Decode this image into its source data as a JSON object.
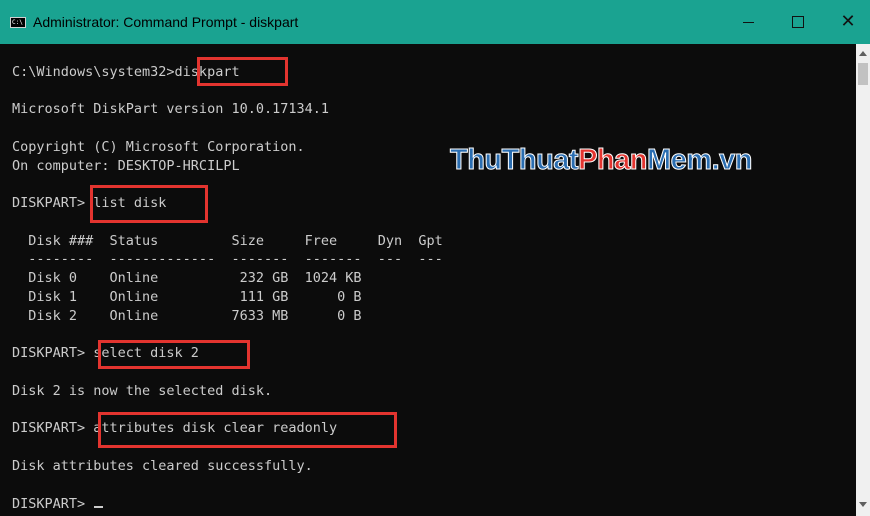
{
  "window": {
    "title": "Administrator: Command Prompt - diskpart",
    "icon_label": "C:\\",
    "minimize_icon": "minimize-icon",
    "maximize_icon": "maximize-icon",
    "close_icon": "close-icon",
    "close_glyph": "✕",
    "title_bar_color": "#1aa391"
  },
  "console": {
    "lines": [
      "C:\\Windows\\system32>diskpart",
      "Microsoft DiskPart version 10.0.17134.1",
      "Copyright (C) Microsoft Corporation.",
      "On computer: DESKTOP-HRCILPL",
      "DISKPART> list disk",
      "  Disk ###  Status         Size     Free     Dyn  Gpt",
      "  --------  -------------  -------  -------  ---  ---",
      "  Disk 0    Online          232 GB  1024 KB",
      "  Disk 1    Online          111 GB      0 B",
      "  Disk 2    Online         7633 MB      0 B",
      "DISKPART> select disk 2",
      "Disk 2 is now the selected disk.",
      "DISKPART> attributes disk clear readonly",
      "Disk attributes cleared successfully.",
      "DISKPART> "
    ],
    "text_color": "#cccccc",
    "background_color": "#0c0c0c",
    "highlight_color": "#e3342f"
  },
  "watermark": {
    "parts": [
      "Thu",
      "Thuat",
      "Phan",
      "Mem",
      ".",
      "vn"
    ]
  }
}
